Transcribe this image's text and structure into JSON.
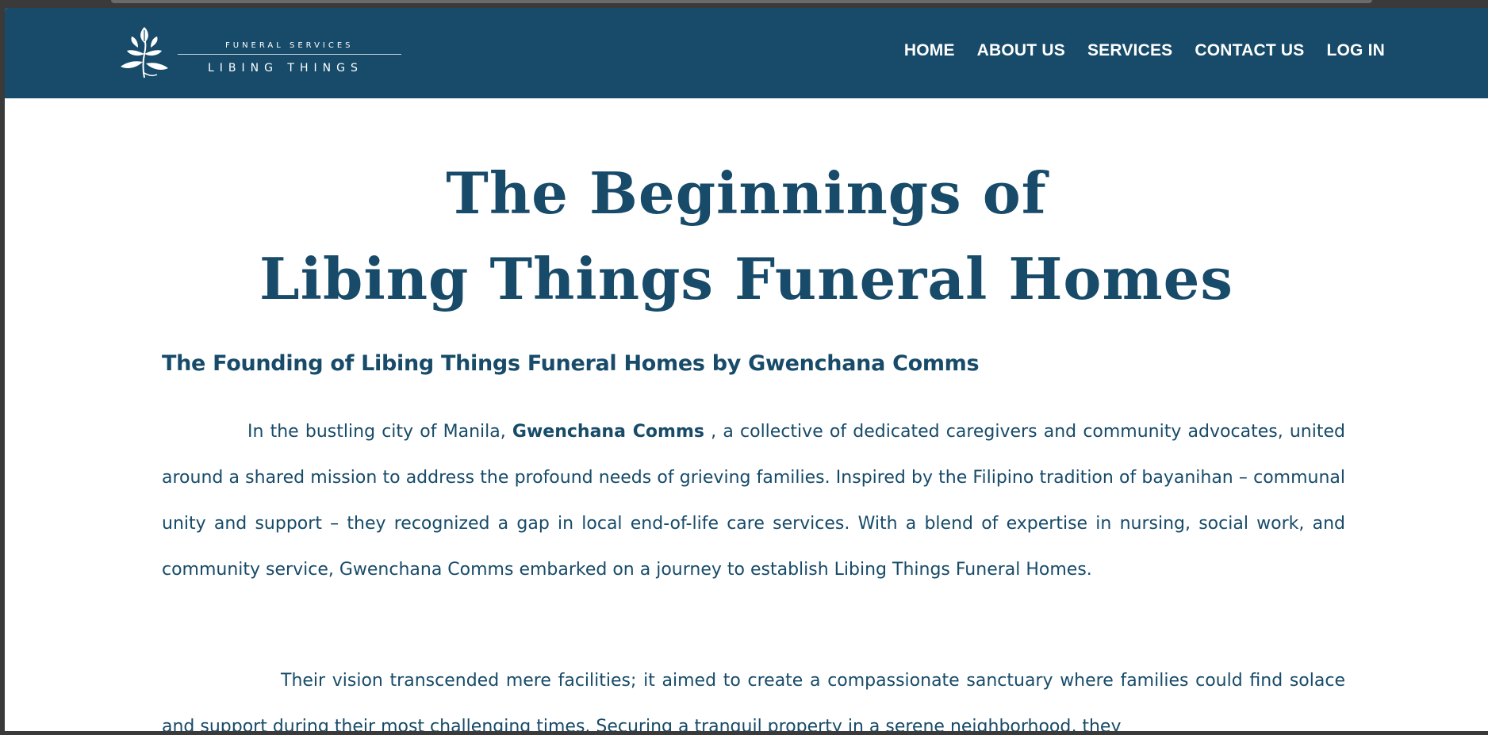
{
  "nav": {
    "logo": {
      "subtitle": "FUNERAL SERVICES",
      "name": "LIBING THINGS",
      "icon": "leaf-sprig-icon"
    },
    "links": [
      "HOME",
      "ABOUT US",
      "SERVICES",
      "CONTACT US",
      "LOG IN"
    ]
  },
  "hero": {
    "title_line1": "The Beginnings of",
    "title_line2": "Libing Things Funeral Homes"
  },
  "section": {
    "heading": "The Founding of Libing Things Funeral Homes by Gwenchana Comms",
    "p1_before": "In the bustling city of Manila, ",
    "p1_bold": "Gwenchana Comms",
    "p1_after": " , a collective of dedicated caregivers and community advocates, united around a shared mission to address the profound needs of grieving families. Inspired by the Filipino tradition of bayanihan – communal unity and support – they recognized a gap in local end-of-life care services. With a blend of expertise in nursing, social work, and community service, Gwenchana Comms embarked on a journey to establish Libing Things Funeral Homes.",
    "p2": "Their vision transcended mere facilities; it aimed to create a compassionate sanctuary where families could find solace and support during their most challenging times. Securing a tranquil property in a serene neighborhood, they"
  },
  "colors": {
    "brand": "#174b69",
    "background": "#ffffff",
    "nav_text": "#ffffff"
  }
}
